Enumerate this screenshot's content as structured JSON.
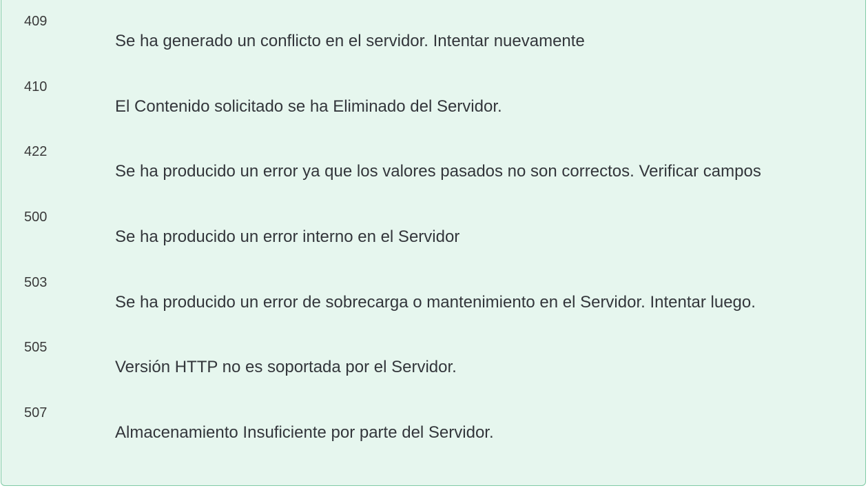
{
  "errors": [
    {
      "code": "409",
      "message": "Se ha generado un conflicto en el servidor. Intentar nuevamente"
    },
    {
      "code": "410",
      "message": "El Contenido solicitado se ha Eliminado del Servidor."
    },
    {
      "code": "422",
      "message": "Se ha producido un error ya que los valores pasados no son correctos. Verificar campos"
    },
    {
      "code": "500",
      "message": "Se ha producido un error interno en el Servidor"
    },
    {
      "code": "503",
      "message": "Se ha producido un error de sobrecarga o mantenimiento en el Servidor. Intentar luego."
    },
    {
      "code": "505",
      "message": "Versión HTTP no es soportada por el Servidor."
    },
    {
      "code": "507",
      "message": "Almacenamiento Insuficiente por parte del Servidor."
    }
  ]
}
